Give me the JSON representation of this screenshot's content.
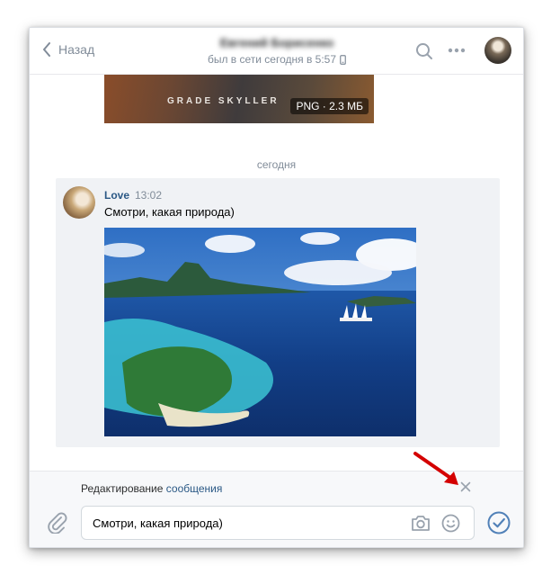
{
  "header": {
    "back_label": "Назад",
    "peer_name": "Евгений Борисенко",
    "peer_status": "был в сети сегодня в 5:57"
  },
  "history": {
    "previous_attachment": {
      "image_caption": "GRADE SKYLLER",
      "badge": "PNG · 2.3 МБ"
    },
    "date_separator": "сегодня",
    "message": {
      "author": "Love",
      "time": "13:02",
      "text": "Смотри, какая природа)"
    }
  },
  "editor": {
    "label_prefix": "Редактирование",
    "label_link": "сообщения",
    "input_value": "Смотри, какая природа)"
  },
  "colors": {
    "link": "#2a5885",
    "accent": "#5181b8",
    "muted": "#818c99",
    "arrow": "#d40000"
  },
  "icons": [
    "chevron-left-icon",
    "search-icon",
    "more-icon",
    "phone-icon",
    "attach-icon",
    "camera-icon",
    "smile-icon",
    "send-check-icon",
    "close-icon"
  ]
}
